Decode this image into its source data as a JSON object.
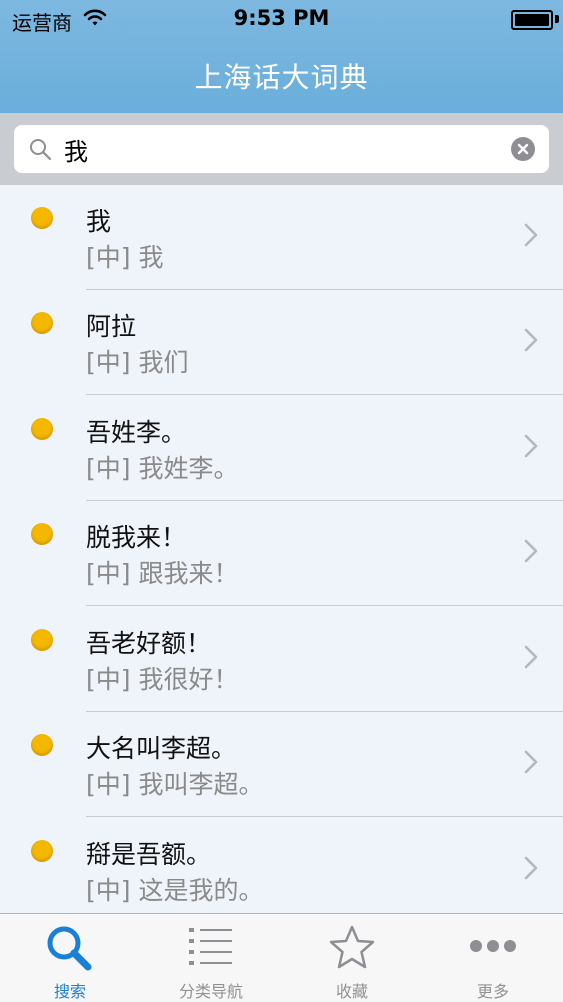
{
  "status_bar": {
    "carrier": "运营商",
    "time": "9:53 PM"
  },
  "nav": {
    "title": "上海话大词典"
  },
  "search": {
    "value": "我"
  },
  "results": [
    {
      "primary": "我",
      "secondary": "[中] 我"
    },
    {
      "primary": "阿拉",
      "secondary": "[中] 我们"
    },
    {
      "primary": "吾姓李。",
      "secondary": "[中] 我姓李。"
    },
    {
      "primary": "脱我来！",
      "secondary": "[中] 跟我来！"
    },
    {
      "primary": "吾老好额！",
      "secondary": "[中] 我很好！"
    },
    {
      "primary": "大名叫李超。",
      "secondary": "[中] 我叫李超。"
    },
    {
      "primary": "搿是吾额。",
      "secondary": "[中] 这是我的。"
    }
  ],
  "tabbar": {
    "tabs": [
      {
        "label": "搜索",
        "icon": "search-icon",
        "active": true
      },
      {
        "label": "分类导航",
        "icon": "list-icon",
        "active": false
      },
      {
        "label": "收藏",
        "icon": "star-icon",
        "active": false
      },
      {
        "label": "更多",
        "icon": "more-icon",
        "active": false
      }
    ]
  },
  "colors": {
    "header": "#6aaedb",
    "accent": "#1a7fd6",
    "bullet": "#f5b800"
  }
}
